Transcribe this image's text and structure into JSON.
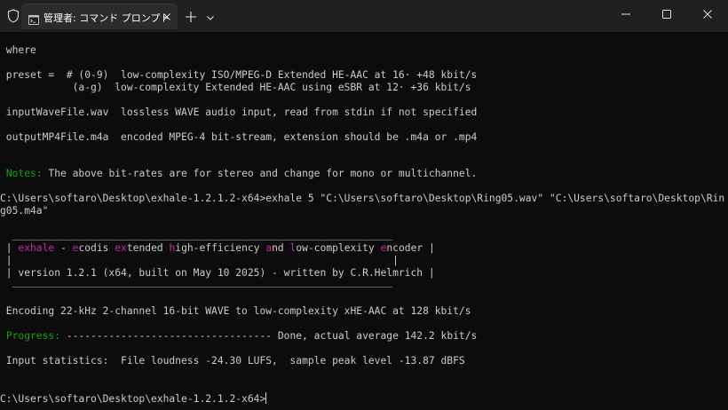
{
  "window": {
    "tab_title": "管理者: コマンド プロンプト",
    "icons": {
      "shield": "shield-icon",
      "tab": "command-prompt-icon",
      "close_tab": "close-icon",
      "new_tab": "plus-icon",
      "dropdown": "chevron-down-icon",
      "minimize": "minimize-icon",
      "maximize": "maximize-icon",
      "close_window": "close-icon"
    }
  },
  "colors": {
    "background": "#0c0c0c",
    "text": "#cccccc",
    "green": "#13a10e",
    "magenta": "#c12aa6",
    "titlebar": "#202020"
  },
  "terminal": {
    "where": " where",
    "preset_1": " preset =  # (0-9)  low-complexity ISO/MPEG-D Extended HE-AAC at 16· +48 kbit/s",
    "preset_2": "            (a-g)  low-complexity Extended HE-AAC using eSBR at 12· +36 kbit/s",
    "input_file": " inputWaveFile.wav  lossless WAVE audio input, read from stdin if not specified",
    "output_file": " outputMP4File.m4a  encoded MPEG-4 bit-stream, extension should be .m4a or .mp4",
    "notes_label": "Notes:",
    "notes_text": " The above bit-rates are for stereo and change for mono or multichannel.",
    "command_1": "C:\\Users\\softaro\\Desktop\\exhale-1.2.1.2-x64>exhale 5 \"C:\\Users\\softaro\\Desktop\\Ring05.wav\" \"C:\\Users\\softaro\\Desktop\\Rin",
    "command_2": "g05.m4a\"",
    "banner_top": "  _______________________________________________________________",
    "banner_left": " | ",
    "banner_exhale": "exhale",
    "banner_dash": " - ",
    "banner_e": "e",
    "banner_codis": "codis ",
    "banner_ex": "ex",
    "banner_tended": "tended ",
    "banner_h": "h",
    "banner_igh": "igh-efficiency ",
    "banner_a": "a",
    "banner_nd": "nd ",
    "banner_l": "l",
    "banner_ow": "ow-complexity ",
    "banner_e2": "e",
    "banner_ncoder": "ncoder |",
    "banner_blank": " |                                                               |",
    "banner_version": " | version 1.2.1 (x64, built on May 10 2025) - written by C.R.Helmrich |",
    "banner_bottom": "  _______________________________________________________________",
    "encoding": " Encoding 22-kHz 2-channel 16-bit WAVE to low-complexity xHE-AAC at 128 kbit/s",
    "progress_label": "Progress:",
    "progress_text": " ---------------------------------- Done, actual average 142.2 kbit/s",
    "input_stats": " Input statistics:  File loudness -24.30 LUFS,  sample peak level -13.87 dBFS",
    "prompt": "C:\\Users\\softaro\\Desktop\\exhale-1.2.1.2-x64>"
  }
}
